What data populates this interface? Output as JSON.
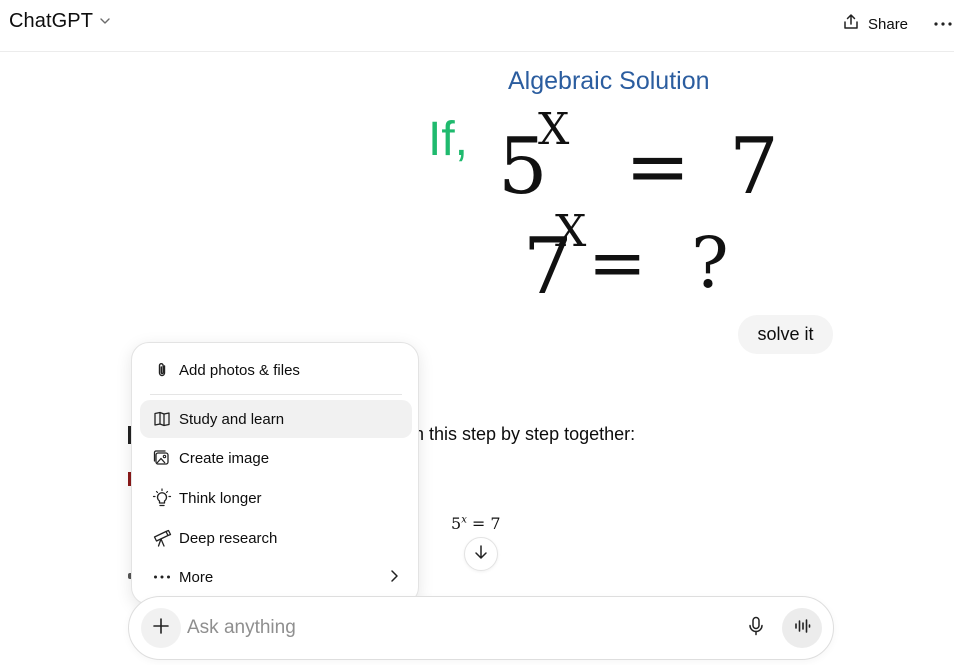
{
  "header": {
    "title": "ChatGPT",
    "share_label": "Share",
    "icons": {
      "chevron": "chevron-down-icon",
      "share": "share-icon",
      "more": "more-horizontal-icon"
    }
  },
  "conversation": {
    "image": {
      "title": "Algebraic Solution",
      "if_text": "If,",
      "line1_base": "5",
      "line1_exp": "X",
      "line1_rest": "= 7",
      "line2_base": "7",
      "line2_exp": "X",
      "line2_rest": "=  ?"
    },
    "user_message": "solve it",
    "assistant_visible_text": "n this step by step together:",
    "assistant_equation_base": "5",
    "assistant_equation_exp": "x",
    "assistant_equation_rest": " = 7"
  },
  "menu": {
    "items": [
      {
        "label": "Add photos & files",
        "icon": "paperclip-icon"
      },
      {
        "label": "Study and learn",
        "icon": "book-icon"
      },
      {
        "label": "Create image",
        "icon": "image-icon"
      },
      {
        "label": "Think longer",
        "icon": "lightbulb-icon"
      },
      {
        "label": "Deep research",
        "icon": "telescope-icon"
      },
      {
        "label": "More",
        "icon": "ellipsis-icon"
      }
    ]
  },
  "composer": {
    "placeholder": "Ask anything",
    "value": "",
    "icons": {
      "plus": "plus-icon",
      "mic": "microphone-icon",
      "voice": "voice-mode-icon"
    }
  },
  "colors": {
    "image_title": "#2b5d9f",
    "image_if": "#1fba6e",
    "menu_active_bg": "#f1f1f1",
    "bubble_bg": "#f4f4f4"
  }
}
